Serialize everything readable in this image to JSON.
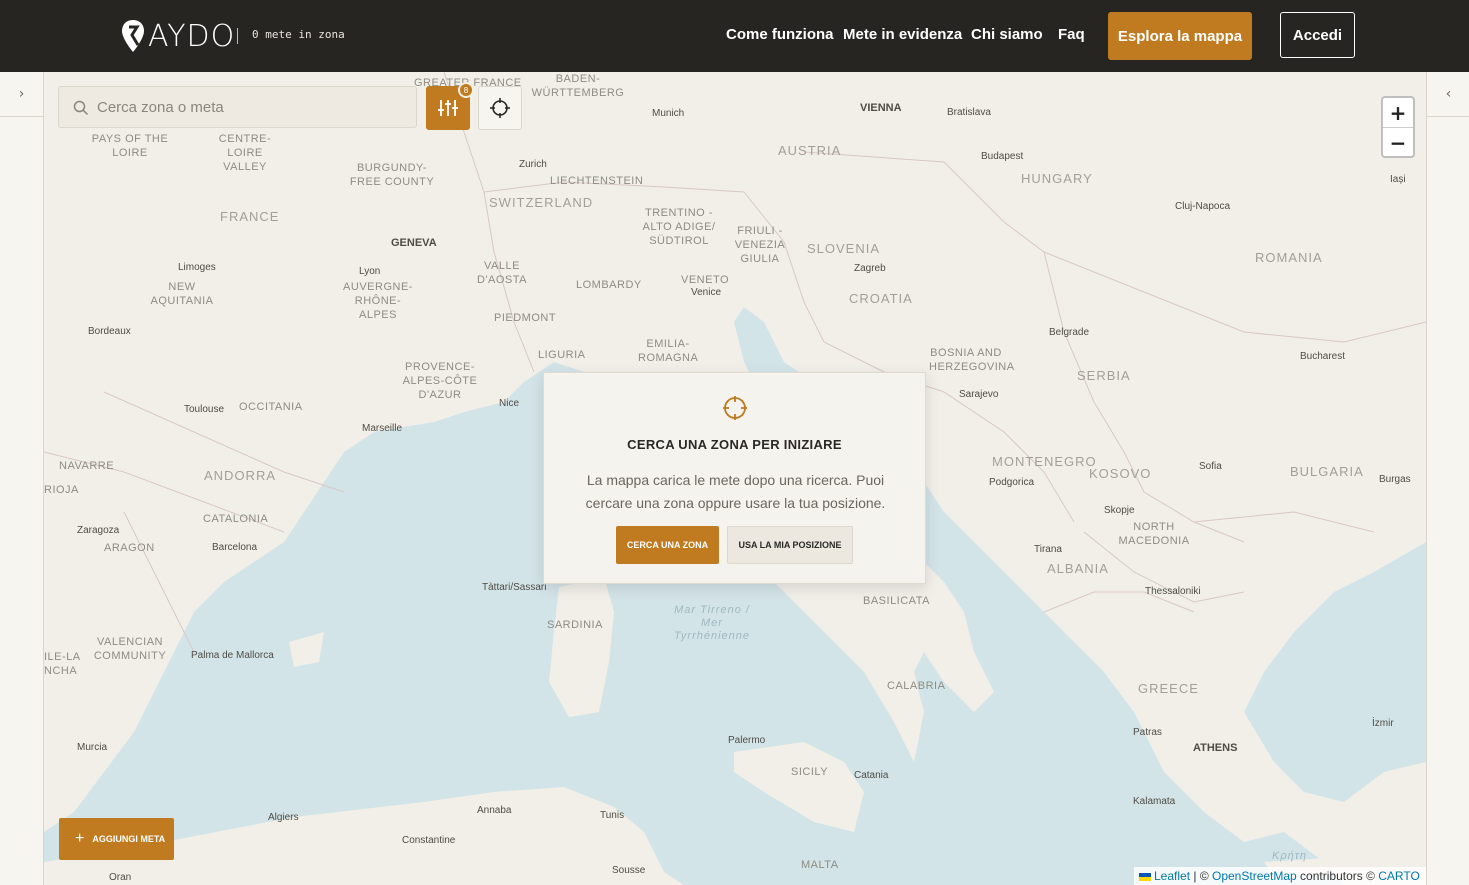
{
  "header": {
    "logo_text": "AYDO",
    "meta_count": "0 mete in zona",
    "nav": [
      "Come funziona",
      "Mete in evidenza",
      "Chi siamo",
      "Faq"
    ],
    "explore_label": "Esplora la mappa",
    "login_label": "Accedi"
  },
  "colors": {
    "accent": "#c07a1f",
    "header_bg": "#262521",
    "sea": "#d3e4e8",
    "land": "#f2efe9"
  },
  "search": {
    "placeholder": "Cerca zona o meta",
    "filter_badge": "8"
  },
  "zoom": {
    "in": "+",
    "out": "−"
  },
  "modal": {
    "icon": "crosshair-icon",
    "title": "CERCA UNA ZONA PER INIZIARE",
    "text": "La mappa carica le mete dopo una ricerca. Puoi cercare una zona oppure usare la tua posizione.",
    "primary_button": "CERCA UNA ZONA",
    "secondary_button": "USA LA MIA POSIZIONE"
  },
  "add_button": "AGGIUNGI META",
  "attribution": {
    "leaflet": "Leaflet",
    "sep1": " | © ",
    "osm": "OpenStreetMap",
    "contrib": " contributors © ",
    "carto": "CARTO"
  },
  "side": {
    "left_chevron": "›",
    "right_chevron": "‹"
  },
  "map_labels": {
    "countries": [
      "FRANCE",
      "SWITZERLAND",
      "AUSTRIA",
      "HUNGARY",
      "SLOVENIA",
      "CROATIA",
      "ROMANIA",
      "SERBIA",
      "BOSNIA AND HERZEGOVINA",
      "MONTENEGRO",
      "KOSOVO",
      "BULGARIA",
      "NORTH MACEDONIA",
      "ALBANIA",
      "GREECE",
      "ANDORRA",
      "LIECHTENSTEIN",
      "MALTA"
    ],
    "regions": [
      "PAYS OF THE LOIRE",
      "CENTRE-LOIRE VALLEY",
      "BURGUNDY-FREE COUNTY",
      "NEW AQUITANIA",
      "AUVERGNE-RHÔNE-ALPES",
      "VALLE D'AOSTA",
      "LOMBARDY",
      "VENETO",
      "TRENTINO - ALTO ADIGE/ SÜDTIROL",
      "FRIULI - VENEZIA GIULIA",
      "PIEDMONT",
      "LIGURIA",
      "EMILIA-ROMAGNA",
      "PROVENCE-ALPES-CÔTE D'AZUR",
      "OCCITANIA",
      "NAVARRE",
      "RIOJA",
      "ARAGON",
      "CATALONIA",
      "VALENCIAN COMMUNITY",
      "SARDINIA",
      "BASILICATA",
      "CALABRIA",
      "SICILY",
      "BADEN-WÜRTTEMBERG",
      "GREATER FRANCE",
      "ILE-LA NCHA"
    ],
    "cities": [
      "Munich",
      "Zurich",
      "Geneva",
      "Lyon",
      "Limoges",
      "Bordeaux",
      "Toulouse",
      "Marseille",
      "Nice",
      "Venice",
      "Zagreb",
      "Belgrade",
      "Bucharest",
      "Budapest",
      "Bratislava",
      "Vienna",
      "Cluj-Napoca",
      "Iași",
      "Sarajevo",
      "Podgorica",
      "Sofia",
      "Skopje",
      "Tirana",
      "Thessaloniki",
      "Athens",
      "Patras",
      "Kalamata",
      "İzmir",
      "Burgas",
      "Barcelona",
      "Zaragoza",
      "Palma de Mallorca",
      "Murcia",
      "Algiers",
      "Annaba",
      "Constantine",
      "Tunis",
      "Sousse",
      "Oran",
      "Palermo",
      "Catania",
      "Tàttari/Sassari"
    ],
    "sea": "Mar Tirreno / Mer Tyrrhénienne",
    "greek": "Κρήτη"
  }
}
